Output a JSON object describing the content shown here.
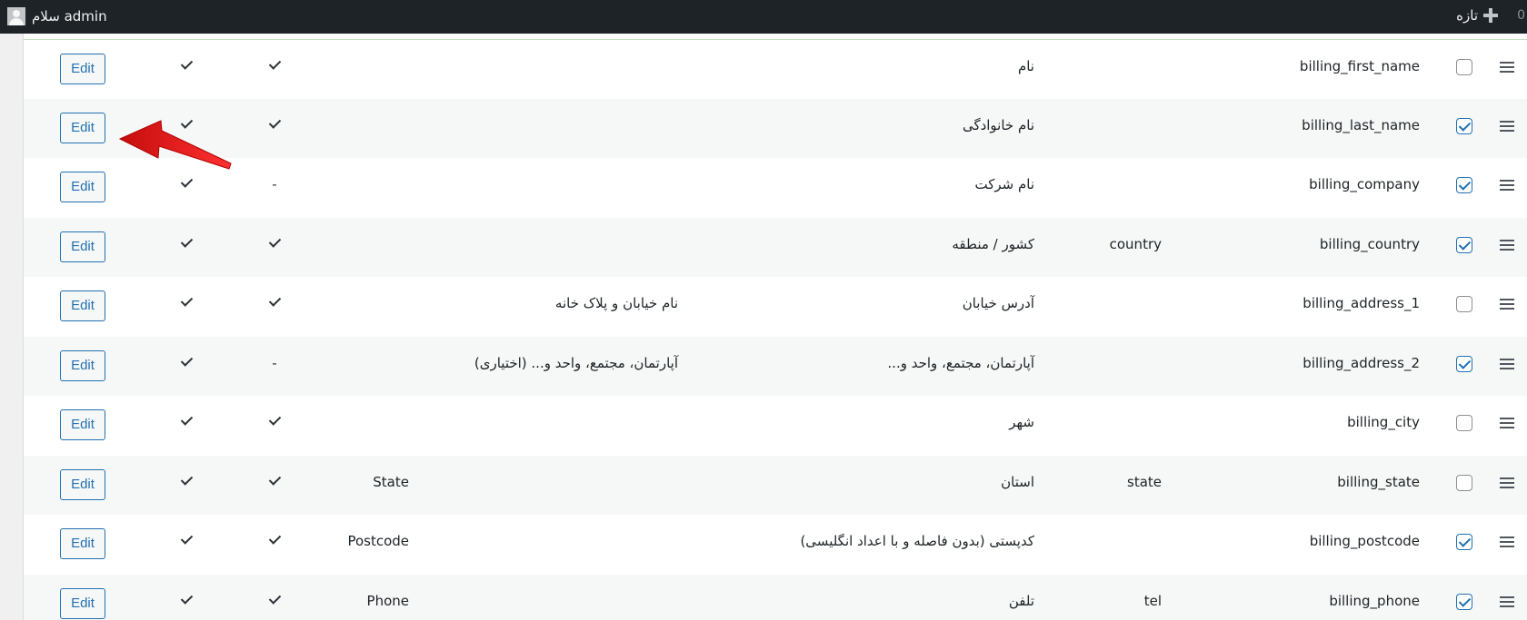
{
  "adminbar": {
    "account_greeting": "سلام admin",
    "new_label": "تازه",
    "edge_count": "0"
  },
  "edit_label": "Edit",
  "rows": [
    {
      "name": "billing_first_name",
      "type": "",
      "label": "نام",
      "placeholder": "",
      "default": "",
      "checked": false,
      "required": "check",
      "enabled": "check"
    },
    {
      "name": "billing_last_name",
      "type": "",
      "label": "نام خانوادگی",
      "placeholder": "",
      "default": "",
      "checked": true,
      "required": "check",
      "enabled": "check"
    },
    {
      "name": "billing_company",
      "type": "",
      "label": "نام شرکت",
      "placeholder": "",
      "default": "",
      "checked": true,
      "required": "-",
      "enabled": "check"
    },
    {
      "name": "billing_country",
      "type": "country",
      "label": "کشور / منطقه",
      "placeholder": "",
      "default": "",
      "checked": true,
      "required": "check",
      "enabled": "check"
    },
    {
      "name": "billing_address_1",
      "type": "",
      "label": "آدرس خیابان",
      "placeholder": "نام خیابان و پلاک خانه",
      "default": "",
      "checked": false,
      "required": "check",
      "enabled": "check"
    },
    {
      "name": "billing_address_2",
      "type": "",
      "label": "آپارتمان، مجتمع، واحد و...",
      "placeholder": "آپارتمان، مجتمع، واحد و... (اختیاری)",
      "default": "",
      "checked": true,
      "required": "-",
      "enabled": "check"
    },
    {
      "name": "billing_city",
      "type": "",
      "label": "شهر",
      "placeholder": "",
      "default": "",
      "checked": false,
      "required": "check",
      "enabled": "check"
    },
    {
      "name": "billing_state",
      "type": "state",
      "label": "استان",
      "placeholder": "",
      "default": "State",
      "checked": false,
      "required": "check",
      "enabled": "check"
    },
    {
      "name": "billing_postcode",
      "type": "",
      "label": "کدپستی (بدون فاصله و با اعداد انگلیسی)",
      "placeholder": "",
      "default": "Postcode",
      "checked": true,
      "required": "check",
      "enabled": "check"
    },
    {
      "name": "billing_phone",
      "type": "tel",
      "label": "تلفن",
      "placeholder": "",
      "default": "Phone",
      "checked": true,
      "required": "check",
      "enabled": "check"
    }
  ],
  "colors": {
    "adminbar": "#1d2327",
    "accent": "#2271b1",
    "annotation_arrow": "#e02020"
  }
}
